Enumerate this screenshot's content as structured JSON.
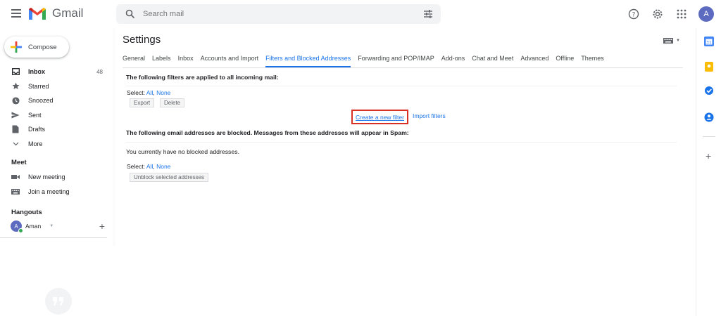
{
  "app": {
    "name": "Gmail"
  },
  "search": {
    "placeholder": "Search mail"
  },
  "account": {
    "initial": "A"
  },
  "compose": {
    "label": "Compose"
  },
  "nav": {
    "items": [
      {
        "label": "Inbox",
        "count": "48",
        "icon": "inbox-icon"
      },
      {
        "label": "Starred",
        "icon": "star-icon"
      },
      {
        "label": "Snoozed",
        "icon": "clock-icon"
      },
      {
        "label": "Sent",
        "icon": "send-icon"
      },
      {
        "label": "Drafts",
        "icon": "draft-icon"
      },
      {
        "label": "More",
        "icon": "chevron-down-icon"
      }
    ]
  },
  "meet": {
    "heading": "Meet",
    "items": [
      {
        "label": "New meeting",
        "icon": "video-icon"
      },
      {
        "label": "Join a meeting",
        "icon": "keyboard-icon"
      }
    ]
  },
  "hangouts": {
    "heading": "Hangouts",
    "user_name": "Aman",
    "user_initial": "A"
  },
  "settings": {
    "title": "Settings",
    "tabs": [
      "General",
      "Labels",
      "Inbox",
      "Accounts and Import",
      "Filters and Blocked Addresses",
      "Forwarding and POP/IMAP",
      "Add-ons",
      "Chat and Meet",
      "Advanced",
      "Offline",
      "Themes"
    ],
    "active_tab": "Filters and Blocked Addresses",
    "filters_heading": "The following filters are applied to all incoming mail:",
    "select_label": "Select:",
    "select_all": "All",
    "select_none": "None",
    "export_label": "Export",
    "delete_label": "Delete",
    "create_filter_label": "Create a new filter",
    "import_filters_label": "Import filters",
    "blocked_heading": "The following email addresses are blocked. Messages from these addresses will appear in Spam:",
    "blocked_empty_text": "You currently have no blocked addresses.",
    "unblock_label": "Unblock selected addresses"
  },
  "colors": {
    "accent": "#1a73e8",
    "highlight_box": "#d93025"
  }
}
